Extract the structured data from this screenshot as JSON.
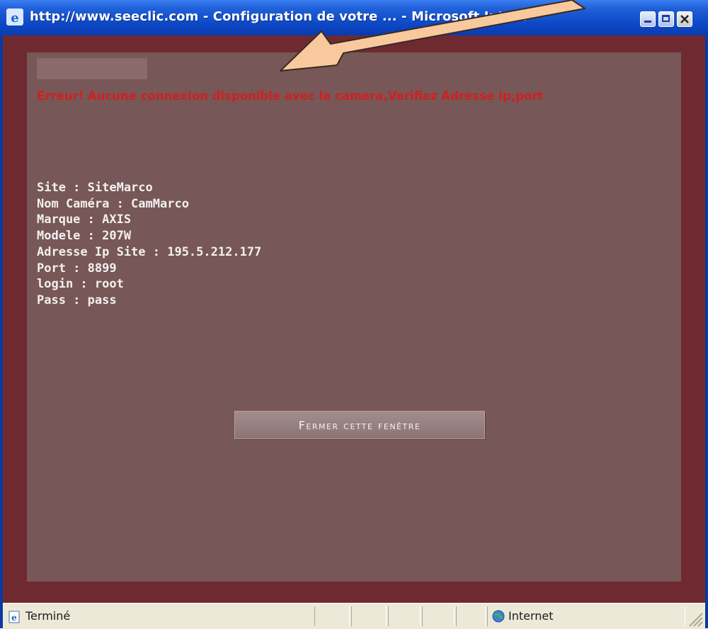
{
  "window": {
    "title": "http://www.seeclic.com - Configuration de votre ... - Microsoft Inte...",
    "icon": "ie-icon",
    "controls": [
      "minimize-icon",
      "maximize-icon",
      "close-icon"
    ]
  },
  "page": {
    "error_message": "Erreur! Aucune connexion disponible avec la camera,Verifiez Adresse Ip,port",
    "info": {
      "site": "Site : SiteMarco",
      "camera": "Nom Caméra : CamMarco",
      "brand": "Marque : AXIS",
      "model": "Modele : 207W",
      "ip": "Adresse Ip Site : 195.5.212.177",
      "port": "Port : 8899",
      "login": "login : root",
      "pass": "Pass : pass"
    },
    "close_button": "Fermer cette fenêtre"
  },
  "statusbar": {
    "status_text": "Terminé",
    "zone_text": "Internet"
  },
  "colors": {
    "page_border": "#6e2a30",
    "panel": "#775757",
    "error": "#d02020",
    "arrow": "#f7c99c"
  }
}
